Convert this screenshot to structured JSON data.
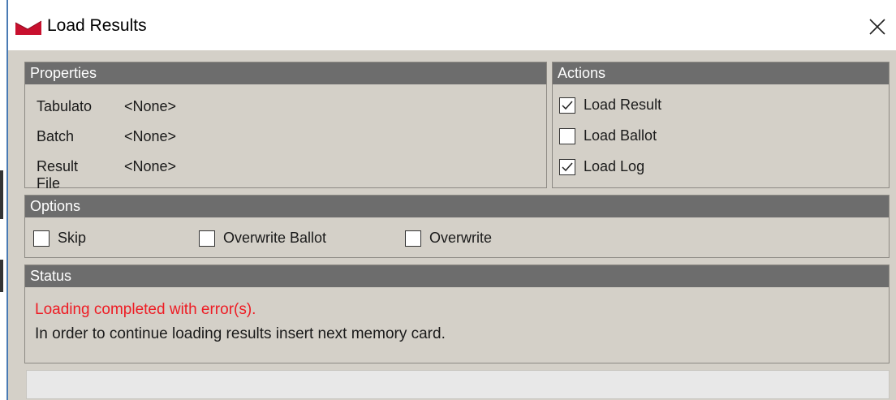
{
  "window": {
    "title": "Load Results",
    "close_glyph": "✕",
    "icon": "app-logo-icon"
  },
  "properties": {
    "header": "Properties",
    "rows": [
      {
        "label": "Tabulato",
        "value": "<None>"
      },
      {
        "label": "Batch",
        "value": "<None>"
      },
      {
        "label": "Result Filе",
        "value": "<None>"
      }
    ]
  },
  "actions": {
    "header": "Actions",
    "items": [
      {
        "label": "Load Result",
        "checked": true
      },
      {
        "label": "Load Ballot",
        "checked": false
      },
      {
        "label": "Load Log",
        "checked": true
      }
    ]
  },
  "options": {
    "header": "Options",
    "items": [
      {
        "label": "Skip",
        "checked": false
      },
      {
        "label": "Overwrite Ballot",
        "checked": false
      },
      {
        "label": "Overwrite",
        "checked": false
      }
    ]
  },
  "status": {
    "header": "Status",
    "error_text": "Loading completed with error(s).",
    "info_text": "In order to continue loading results insert next memory card.",
    "error_color": "#ee1c24",
    "info_color": "#1a1a1a"
  },
  "colors": {
    "panel_header_bg": "#6d6d6d",
    "client_bg": "#d4d0c8",
    "icon_red": "#c8102e"
  }
}
